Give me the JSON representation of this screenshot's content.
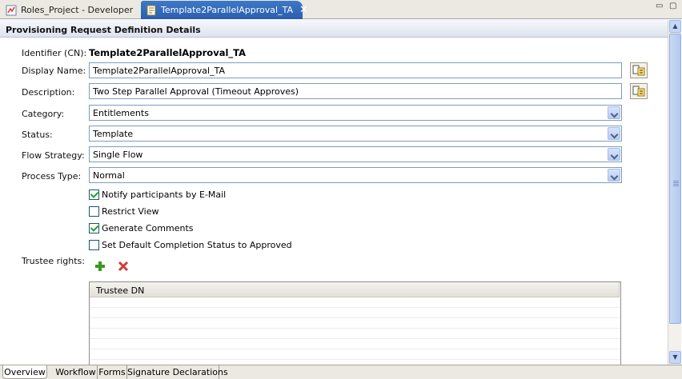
{
  "tabs": [
    {
      "label": "Roles_Project - Developer",
      "active": false
    },
    {
      "label": "Template2ParallelApproval_TA",
      "active": true
    }
  ],
  "section_title": "Provisioning Request Definition Details",
  "form": {
    "identifier_label": "Identifier (CN):",
    "identifier_value": "Template2ParallelApproval_TA",
    "display_name_label": "Display Name:",
    "display_name_value": "Template2ParallelApproval_TA",
    "description_label": "Description:",
    "description_value": "Two Step Parallel Approval (Timeout Approves)",
    "category_label": "Category:",
    "category_value": "Entitlements",
    "status_label": "Status:",
    "status_value": "Template",
    "flow_strategy_label": "Flow Strategy:",
    "flow_strategy_value": "Single Flow",
    "process_type_label": "Process Type:",
    "process_type_value": "Normal"
  },
  "checkboxes": [
    {
      "label": "Notify participants by E-Mail",
      "checked": true
    },
    {
      "label": "Restrict View",
      "checked": false
    },
    {
      "label": "Generate Comments",
      "checked": true
    },
    {
      "label": "Set Default Completion Status to Approved",
      "checked": false
    }
  ],
  "trustee": {
    "label": "Trustee rights:",
    "column_header": "Trustee DN",
    "add_icon": "plus-icon",
    "remove_icon": "delete-x-icon"
  },
  "page_tabs": [
    {
      "label": "Overview",
      "selected": true
    },
    {
      "label": "Workflow",
      "selected": false
    },
    {
      "label": "Forms",
      "selected": false
    },
    {
      "label": "Signature Declarations",
      "selected": false
    }
  ],
  "colors": {
    "active_tab": "#2a5fad",
    "section_header": "#dde4ef",
    "field_border": "#7f9db9",
    "check_mark": "#21a121",
    "add_icon": "#3a9a1e",
    "remove_icon": "#d23a3a"
  }
}
